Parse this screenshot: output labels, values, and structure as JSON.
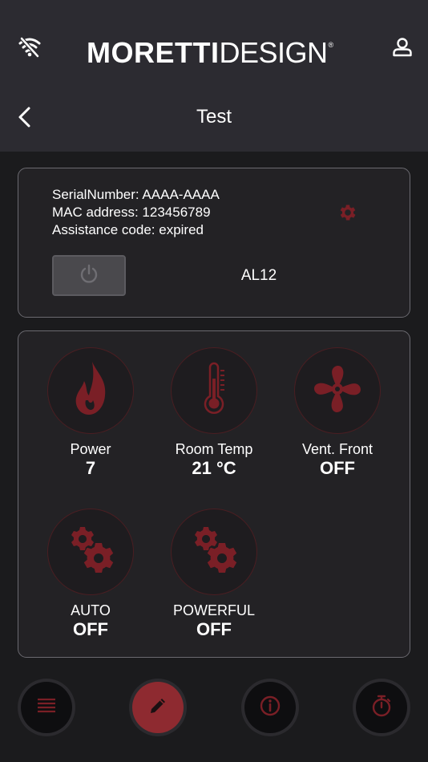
{
  "header": {
    "brand_strong": "MORETTI",
    "brand_light": "DESIGN",
    "brand_reg": "®",
    "title": "Test",
    "icons": [
      "wifi-off-icon",
      "user-icon",
      "chevron-left-icon"
    ]
  },
  "device": {
    "serial_line": "SerialNumber: AAAA-AAAA",
    "mac_line": "MAC address: 123456789",
    "assistance_line": "Assistance code: expired",
    "model": "AL12",
    "icons": [
      "gear-icon",
      "power-icon"
    ]
  },
  "controls": [
    {
      "label": "Power",
      "value": "7",
      "icon": "flame-icon"
    },
    {
      "label": "Room Temp",
      "value": "21 °C",
      "icon": "thermometer-icon"
    },
    {
      "label": "Vent. Front",
      "value": "OFF",
      "icon": "fan-icon"
    },
    {
      "label": "AUTO",
      "value": "OFF",
      "icon": "gears-icon"
    },
    {
      "label": "POWERFUL",
      "value": "OFF",
      "icon": "gears-icon"
    }
  ],
  "bottom_nav": [
    {
      "icon": "list-icon",
      "active": false
    },
    {
      "icon": "pencil-icon",
      "active": true
    },
    {
      "icon": "info-icon",
      "active": false
    },
    {
      "icon": "timer-icon",
      "active": false
    }
  ],
  "colors": {
    "accent": "#8e2a30",
    "icon_red": "#7a1f26",
    "header_bg": "#2c2b31",
    "page_bg": "#1b1b1d"
  }
}
